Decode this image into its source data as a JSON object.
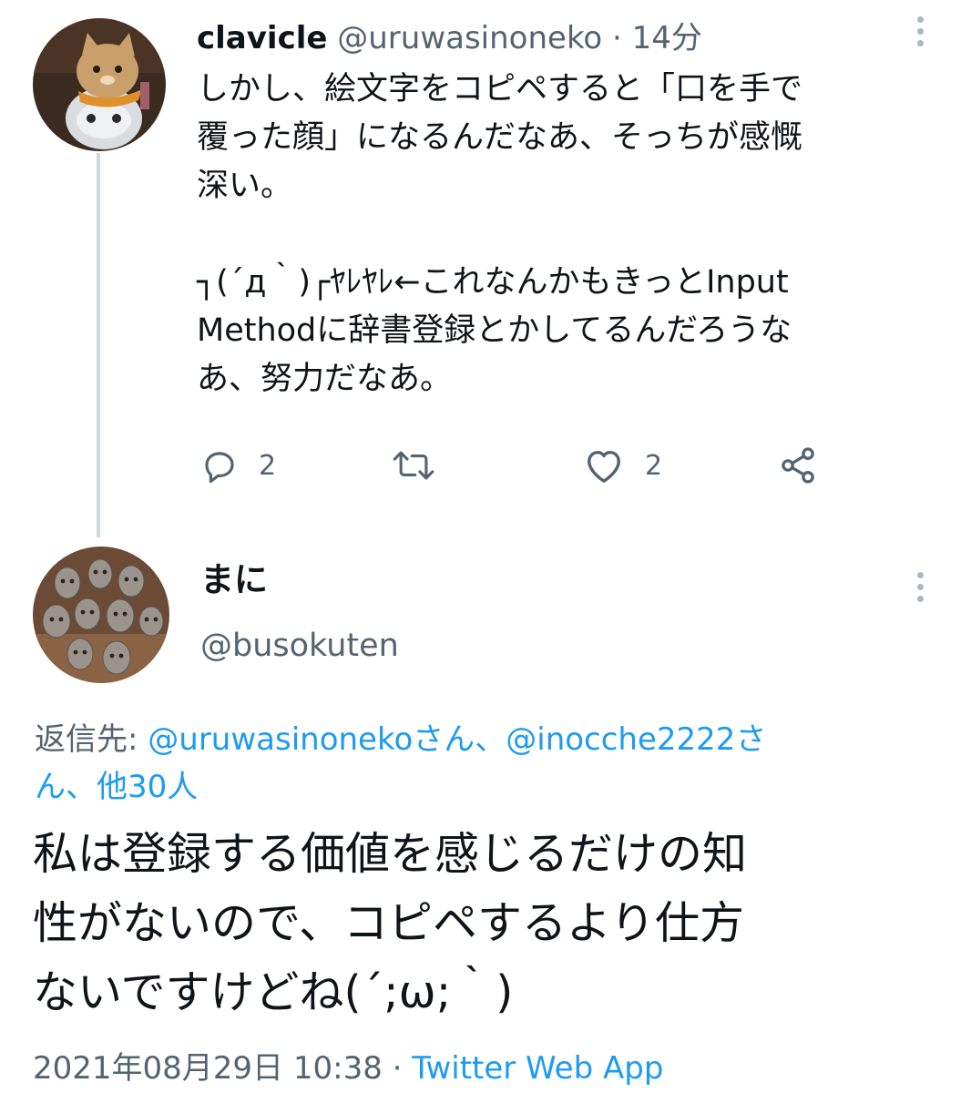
{
  "tweet1": {
    "name": "clavicle",
    "handle": "@uruwasinoneko",
    "separator": "·",
    "time": "14分",
    "text": "しかし、絵文字をコピペすると「口を手で\n覆った顔」になるんだなあ、そっちが感慨\n深い。\n\n┐(´д｀)┌ﾔﾚﾔﾚ←これなんかもきっとInput\nMethodに辞書登録とかしてるんだろうな\nあ、努力だなあ。",
    "reply_count": "2",
    "like_count": "2"
  },
  "tweet2": {
    "name": "まに",
    "handle": "@busokuten",
    "reply_to": {
      "prefix": "返信先: ",
      "mention1": "@uruwasinoneko",
      "suffix1": "さん、",
      "mention2": "@inocche2222",
      "suffix2": "さ\nん、",
      "others": "他30人"
    },
    "text": "私は登録する価値を感じるだけの知\n性がないので、コピペするより仕方\nないですけどね(´;ω;｀)",
    "timestamp": "2021年08月29日 10:38",
    "separator": "·",
    "source": "Twitter Web App"
  },
  "colors": {
    "text_primary": "#0f1419",
    "text_secondary": "#536471",
    "link": "#1d9bf0",
    "thread_line": "#cfd9de"
  },
  "icons": {
    "reply": "reply-icon",
    "retweet": "retweet-icon",
    "like": "heart-icon",
    "share": "share-icon",
    "more": "more-vertical-icon"
  }
}
